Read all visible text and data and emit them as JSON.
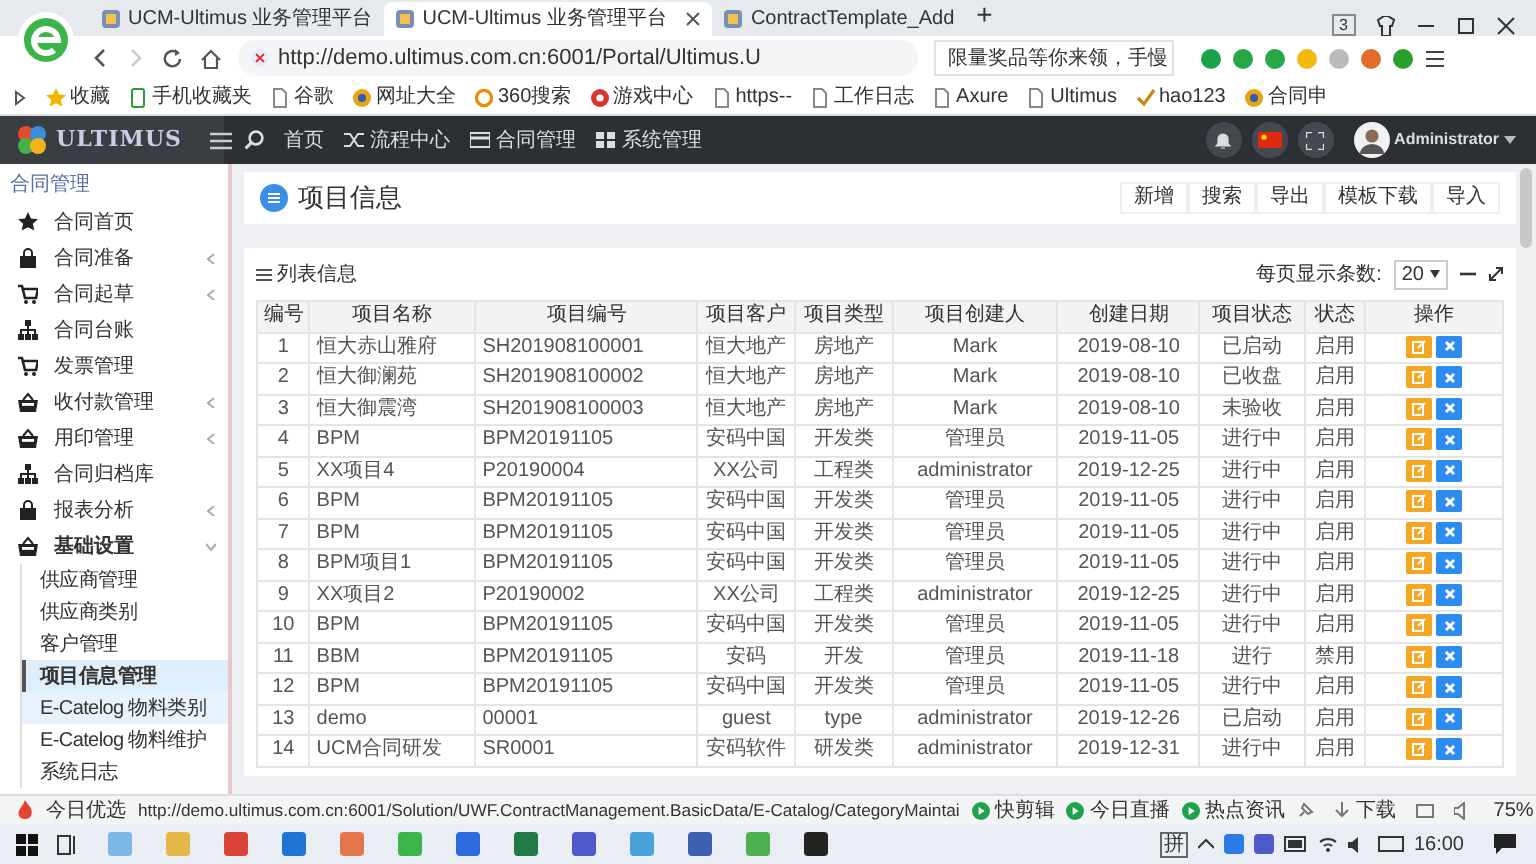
{
  "browser": {
    "tabs": [
      {
        "title": "UCM-Ultimus 业务管理平台",
        "selected": false
      },
      {
        "title": "UCM-Ultimus 业务管理平台",
        "selected": true
      },
      {
        "title": "ContractTemplate_Add",
        "selected": false
      }
    ],
    "new_tab": "+",
    "tab_count": "3",
    "url": "http://demo.ultimus.com.cn:6001/Portal/Ultimus.U",
    "search_text": "限量奖品等你来领，手慢",
    "bookmarks": [
      {
        "label": "收藏",
        "kind": "star"
      },
      {
        "label": "手机收藏夹",
        "kind": "phone"
      },
      {
        "label": "谷歌",
        "kind": "page"
      },
      {
        "label": "网址大全",
        "kind": "globe"
      },
      {
        "label": "360搜索",
        "kind": "search"
      },
      {
        "label": "游戏中心",
        "kind": "game"
      },
      {
        "label": "https--",
        "kind": "page"
      },
      {
        "label": "工作日志",
        "kind": "page"
      },
      {
        "label": "Axure",
        "kind": "page"
      },
      {
        "label": "Ultimus",
        "kind": "page"
      },
      {
        "label": "hao123",
        "kind": "check"
      },
      {
        "label": "合同申",
        "kind": "globe"
      }
    ]
  },
  "header": {
    "logo": "ULTIMUS",
    "nav": [
      "首页",
      "流程中心",
      "合同管理",
      "系统管理"
    ],
    "user": "Administrator"
  },
  "sidebar": {
    "section": "合同管理",
    "items": [
      {
        "label": "合同首页",
        "kind": "star",
        "expandable": false,
        "expanded": false
      },
      {
        "label": "合同准备",
        "kind": "bag",
        "expandable": true,
        "expanded": false
      },
      {
        "label": "合同起草",
        "kind": "cart",
        "expandable": true,
        "expanded": false
      },
      {
        "label": "合同台账",
        "kind": "sitemap",
        "expandable": false,
        "expanded": false
      },
      {
        "label": "发票管理",
        "kind": "cart",
        "expandable": false,
        "expanded": false
      },
      {
        "label": "收付款管理",
        "kind": "basket",
        "expandable": true,
        "expanded": false
      },
      {
        "label": "用印管理",
        "kind": "basket",
        "expandable": true,
        "expanded": false
      },
      {
        "label": "合同归档库",
        "kind": "sitemap",
        "expandable": false,
        "expanded": false
      },
      {
        "label": "报表分析",
        "kind": "bag",
        "expandable": true,
        "expanded": false
      },
      {
        "label": "基础设置",
        "kind": "basket",
        "expandable": true,
        "expanded": true,
        "children": [
          {
            "label": "供应商管理",
            "selected": false,
            "hovered": false
          },
          {
            "label": "供应商类别",
            "selected": false,
            "hovered": false
          },
          {
            "label": "客户管理",
            "selected": false,
            "hovered": false
          },
          {
            "label": "项目信息管理",
            "selected": true,
            "hovered": false
          },
          {
            "label": "E-Catelog 物料类别",
            "selected": false,
            "hovered": true
          },
          {
            "label": "E-Catelog 物料维护",
            "selected": false,
            "hovered": false
          },
          {
            "label": "系统日志",
            "selected": false,
            "hovered": false
          }
        ]
      }
    ]
  },
  "page": {
    "title": "项目信息",
    "actions": [
      "新增",
      "搜索",
      "导出",
      "模板下载",
      "导入"
    ],
    "card_title": "列表信息",
    "page_size_label": "每页显示条数:",
    "page_size": "20"
  },
  "table": {
    "columns": [
      "编号",
      "项目名称",
      "项目编号",
      "项目客户",
      "项目类型",
      "项目创建人",
      "创建日期",
      "项目状态",
      "状态",
      "操作"
    ],
    "rows": [
      [
        "1",
        "恒大赤山雅府",
        "SH201908100001",
        "恒大地产",
        "房地产",
        "Mark",
        "2019-08-10",
        "已启动",
        "启用"
      ],
      [
        "2",
        "恒大御澜苑",
        "SH201908100002",
        "恒大地产",
        "房地产",
        "Mark",
        "2019-08-10",
        "已收盘",
        "启用"
      ],
      [
        "3",
        "恒大御震湾",
        "SH201908100003",
        "恒大地产",
        "房地产",
        "Mark",
        "2019-08-10",
        "未验收",
        "启用"
      ],
      [
        "4",
        "BPM",
        "BPM20191105",
        "安码中国",
        "开发类",
        "管理员",
        "2019-11-05",
        "进行中",
        "启用"
      ],
      [
        "5",
        "XX项目4",
        "P20190004",
        "XX公司",
        "工程类",
        "administrator",
        "2019-12-25",
        "进行中",
        "启用"
      ],
      [
        "6",
        "BPM",
        "BPM20191105",
        "安码中国",
        "开发类",
        "管理员",
        "2019-11-05",
        "进行中",
        "启用"
      ],
      [
        "7",
        "BPM",
        "BPM20191105",
        "安码中国",
        "开发类",
        "管理员",
        "2019-11-05",
        "进行中",
        "启用"
      ],
      [
        "8",
        "BPM项目1",
        "BPM20191105",
        "安码中国",
        "开发类",
        "管理员",
        "2019-11-05",
        "进行中",
        "启用"
      ],
      [
        "9",
        "XX项目2",
        "P20190002",
        "XX公司",
        "工程类",
        "administrator",
        "2019-12-25",
        "进行中",
        "启用"
      ],
      [
        "10",
        "BPM",
        "BPM20191105",
        "安码中国",
        "开发类",
        "管理员",
        "2019-11-05",
        "进行中",
        "启用"
      ],
      [
        "11",
        "BBM",
        "BPM20191105",
        "安码",
        "开发",
        "管理员",
        "2019-11-18",
        "进行",
        "禁用"
      ],
      [
        "12",
        "BPM",
        "BPM20191105",
        "安码中国",
        "开发类",
        "管理员",
        "2019-11-05",
        "进行中",
        "启用"
      ],
      [
        "13",
        "demo",
        "00001",
        "guest",
        "type",
        "administrator",
        "2019-12-26",
        "已启动",
        "启用"
      ],
      [
        "14",
        "UCM合同研发",
        "SR0001",
        "安码软件",
        "研发类",
        "administrator",
        "2019-12-31",
        "进行中",
        "启用"
      ]
    ]
  },
  "status_bar": {
    "label": "今日优选",
    "url": "http://demo.ultimus.com.cn:6001/Solution/UWF.ContractManagement.BasicData/E-Catalog/CategoryMaintai",
    "items": [
      "快剪辑",
      "今日直播",
      "热点资讯"
    ],
    "download": "下载",
    "zoom": "75%"
  },
  "taskbar": {
    "ime": "拼",
    "time": "16:00"
  }
}
